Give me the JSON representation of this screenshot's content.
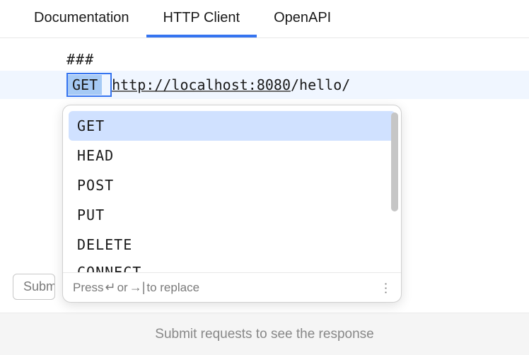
{
  "tabs": [
    {
      "label": "Documentation",
      "active": false
    },
    {
      "label": "HTTP Client",
      "active": true
    },
    {
      "label": "OpenAPI",
      "active": false
    }
  ],
  "editor": {
    "separator": "###",
    "method": "GET",
    "url_host": "http://localhost:8080",
    "url_path": "/hello/"
  },
  "autocomplete": {
    "items": [
      {
        "label": "GET",
        "selected": true
      },
      {
        "label": "HEAD",
        "selected": false
      },
      {
        "label": "POST",
        "selected": false
      },
      {
        "label": "PUT",
        "selected": false
      },
      {
        "label": "DELETE",
        "selected": false
      },
      {
        "label": "CONNECT",
        "selected": false
      }
    ],
    "footer_prefix": "Press ",
    "footer_key1": "↵",
    "footer_mid": " or ",
    "footer_key2": "→|",
    "footer_suffix": " to replace"
  },
  "bottom": {
    "submit_label": "Submit",
    "hint": "Submit requests to see the response"
  }
}
